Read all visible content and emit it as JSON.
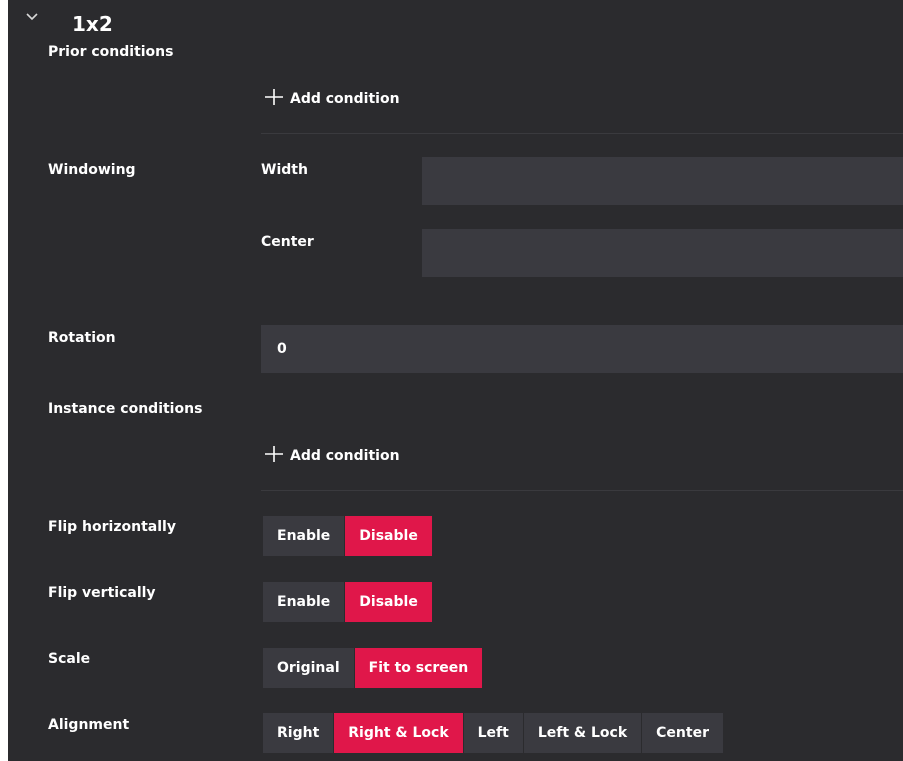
{
  "section": {
    "title": "1x2"
  },
  "prior_conditions": {
    "label": "Prior conditions",
    "add_label": "Add condition"
  },
  "windowing": {
    "label": "Windowing",
    "width_label": "Width",
    "width_value": "",
    "center_label": "Center",
    "center_value": ""
  },
  "rotation": {
    "label": "Rotation",
    "value": "0"
  },
  "instance_conditions": {
    "label": "Instance conditions",
    "add_label": "Add condition"
  },
  "flip_horizontally": {
    "label": "Flip horizontally",
    "options": [
      "Enable",
      "Disable"
    ],
    "selected": "Disable"
  },
  "flip_vertically": {
    "label": "Flip vertically",
    "options": [
      "Enable",
      "Disable"
    ],
    "selected": "Disable"
  },
  "scale": {
    "label": "Scale",
    "options": [
      "Original",
      "Fit to screen"
    ],
    "selected": "Fit to screen"
  },
  "alignment": {
    "label": "Alignment",
    "options": [
      "Right",
      "Right & Lock",
      "Left",
      "Left & Lock",
      "Center"
    ],
    "selected": "Right & Lock"
  },
  "colors": {
    "background": "#2b2b2e",
    "field": "#3a3a40",
    "accent": "#e0174a"
  }
}
